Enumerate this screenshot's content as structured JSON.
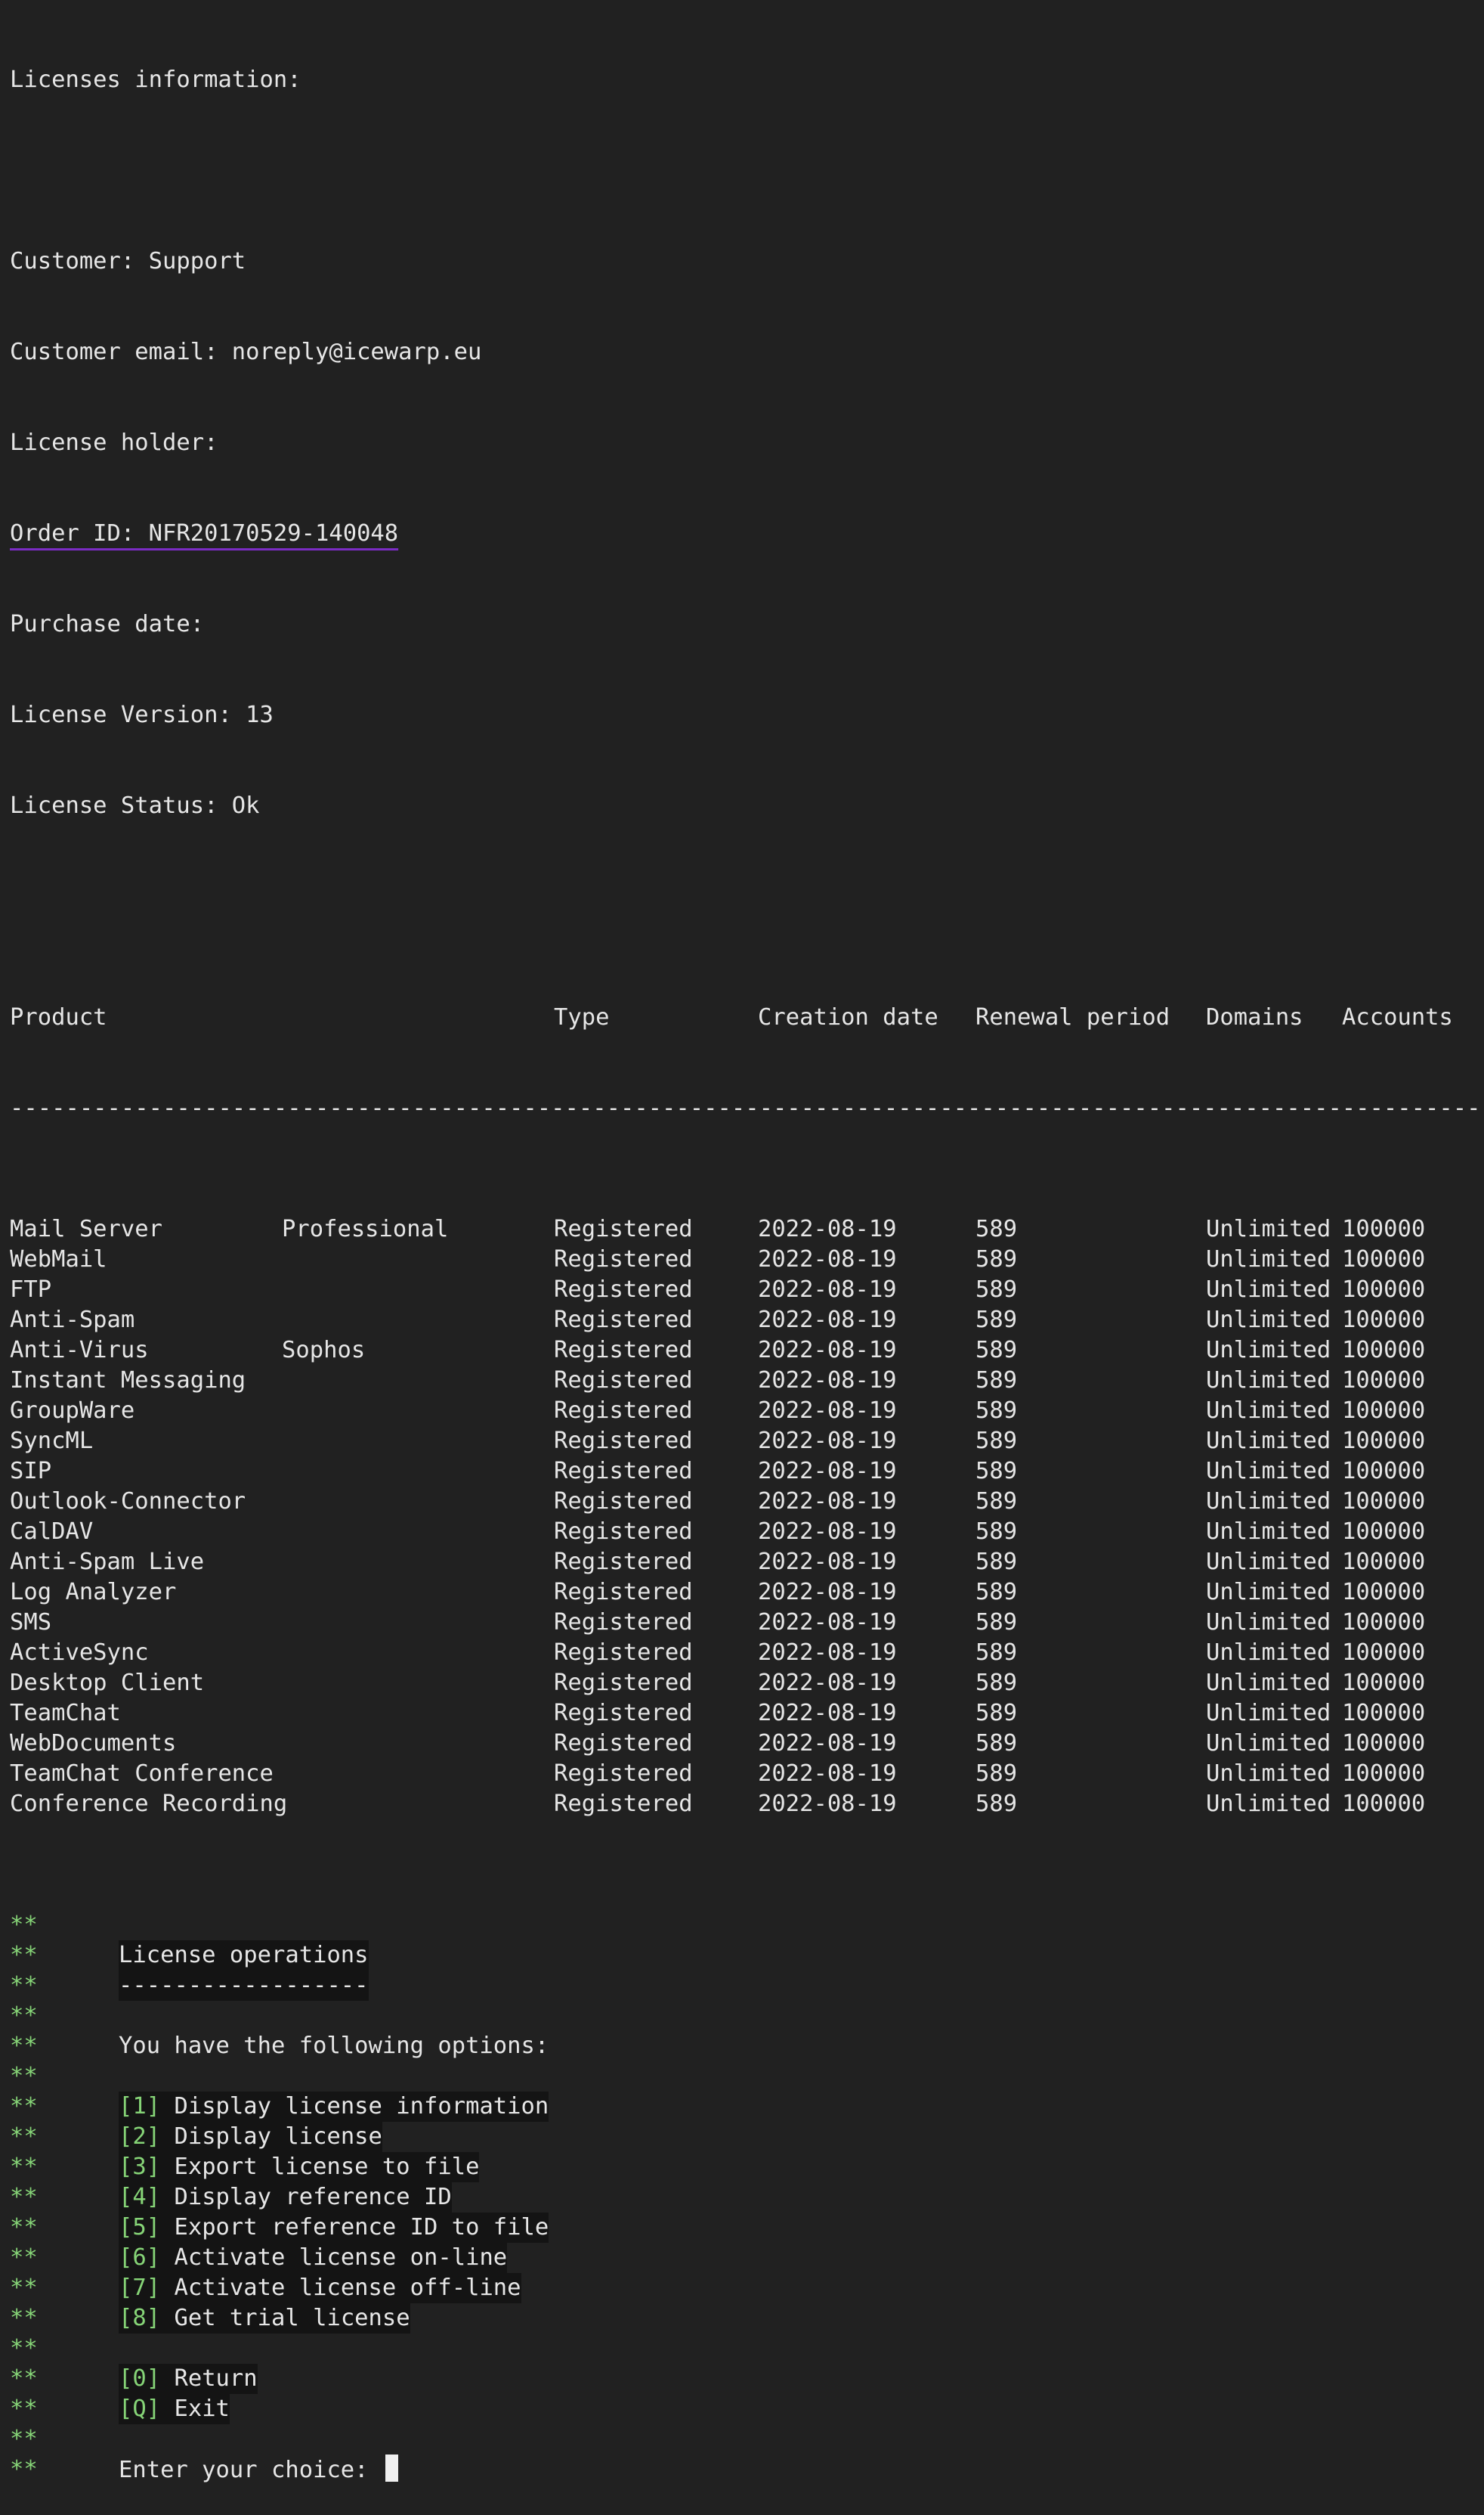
{
  "header": {
    "title": "Licenses information:",
    "customer": "Customer: Support",
    "customer_email": "Customer email: noreply@icewarp.eu",
    "license_holder": "License holder:",
    "order_id": "Order ID: NFR20170529-140048",
    "purchase_date": "Purchase date:",
    "license_version": "License Version: 13",
    "license_status": "License Status: Ok"
  },
  "table": {
    "columns": [
      "Product",
      "Type",
      "Creation date",
      "Renewal period",
      "Domains",
      "Accounts"
    ],
    "separator": "-----------------------------------------------------------------------------------------------------------",
    "rows": [
      {
        "product": "Mail Server",
        "edition": "Professional",
        "type": "Registered",
        "created": "2022-08-19",
        "renewal": "589",
        "domains": "Unlimited",
        "accounts": "100000"
      },
      {
        "product": "WebMail",
        "edition": "",
        "type": "Registered",
        "created": "2022-08-19",
        "renewal": "589",
        "domains": "Unlimited",
        "accounts": "100000"
      },
      {
        "product": "FTP",
        "edition": "",
        "type": "Registered",
        "created": "2022-08-19",
        "renewal": "589",
        "domains": "Unlimited",
        "accounts": "100000"
      },
      {
        "product": "Anti-Spam",
        "edition": "",
        "type": "Registered",
        "created": "2022-08-19",
        "renewal": "589",
        "domains": "Unlimited",
        "accounts": "100000"
      },
      {
        "product": "Anti-Virus",
        "edition": "Sophos",
        "type": "Registered",
        "created": "2022-08-19",
        "renewal": "589",
        "domains": "Unlimited",
        "accounts": "100000"
      },
      {
        "product": "Instant Messaging",
        "edition": "",
        "type": "Registered",
        "created": "2022-08-19",
        "renewal": "589",
        "domains": "Unlimited",
        "accounts": "100000"
      },
      {
        "product": "GroupWare",
        "edition": "",
        "type": "Registered",
        "created": "2022-08-19",
        "renewal": "589",
        "domains": "Unlimited",
        "accounts": "100000"
      },
      {
        "product": "SyncML",
        "edition": "",
        "type": "Registered",
        "created": "2022-08-19",
        "renewal": "589",
        "domains": "Unlimited",
        "accounts": "100000"
      },
      {
        "product": "SIP",
        "edition": "",
        "type": "Registered",
        "created": "2022-08-19",
        "renewal": "589",
        "domains": "Unlimited",
        "accounts": "100000"
      },
      {
        "product": "Outlook-Connector",
        "edition": "",
        "type": "Registered",
        "created": "2022-08-19",
        "renewal": "589",
        "domains": "Unlimited",
        "accounts": "100000"
      },
      {
        "product": "CalDAV",
        "edition": "",
        "type": "Registered",
        "created": "2022-08-19",
        "renewal": "589",
        "domains": "Unlimited",
        "accounts": "100000"
      },
      {
        "product": "Anti-Spam Live",
        "edition": "",
        "type": "Registered",
        "created": "2022-08-19",
        "renewal": "589",
        "domains": "Unlimited",
        "accounts": "100000"
      },
      {
        "product": "Log Analyzer",
        "edition": "",
        "type": "Registered",
        "created": "2022-08-19",
        "renewal": "589",
        "domains": "Unlimited",
        "accounts": "100000"
      },
      {
        "product": "SMS",
        "edition": "",
        "type": "Registered",
        "created": "2022-08-19",
        "renewal": "589",
        "domains": "Unlimited",
        "accounts": "100000"
      },
      {
        "product": "ActiveSync",
        "edition": "",
        "type": "Registered",
        "created": "2022-08-19",
        "renewal": "589",
        "domains": "Unlimited",
        "accounts": "100000"
      },
      {
        "product": "Desktop Client",
        "edition": "",
        "type": "Registered",
        "created": "2022-08-19",
        "renewal": "589",
        "domains": "Unlimited",
        "accounts": "100000"
      },
      {
        "product": "TeamChat",
        "edition": "",
        "type": "Registered",
        "created": "2022-08-19",
        "renewal": "589",
        "domains": "Unlimited",
        "accounts": "100000"
      },
      {
        "product": "WebDocuments",
        "edition": "",
        "type": "Registered",
        "created": "2022-08-19",
        "renewal": "589",
        "domains": "Unlimited",
        "accounts": "100000"
      },
      {
        "product": "TeamChat Conference",
        "edition": "",
        "type": "Registered",
        "created": "2022-08-19",
        "renewal": "589",
        "domains": "Unlimited",
        "accounts": "100000"
      },
      {
        "product": "Conference Recording",
        "edition": "",
        "type": "Registered",
        "created": "2022-08-19",
        "renewal": "589",
        "domains": "Unlimited",
        "accounts": "100000"
      }
    ]
  },
  "menu": {
    "prefix": "**",
    "title": "License operations",
    "title_underline": "------------------",
    "intro": "You have the following options:",
    "options": [
      {
        "key": "[1]",
        "label": "Display license information"
      },
      {
        "key": "[2]",
        "label": "Display license"
      },
      {
        "key": "[3]",
        "label": "Export license to file"
      },
      {
        "key": "[4]",
        "label": "Display reference ID"
      },
      {
        "key": "[5]",
        "label": "Export reference ID to file"
      },
      {
        "key": "[6]",
        "label": "Activate license on-line"
      },
      {
        "key": "[7]",
        "label": "Activate license off-line"
      },
      {
        "key": "[8]",
        "label": "Get trial license"
      }
    ],
    "exit_options": [
      {
        "key": "[0]",
        "label": "Return"
      },
      {
        "key": "[Q]",
        "label": "Exit"
      }
    ],
    "prompt": "Enter your choice: "
  },
  "colors": {
    "background": "#212121",
    "text": "#e6e6e6",
    "accent_green": "#86d477",
    "underline_purple": "#7b2cc4"
  }
}
